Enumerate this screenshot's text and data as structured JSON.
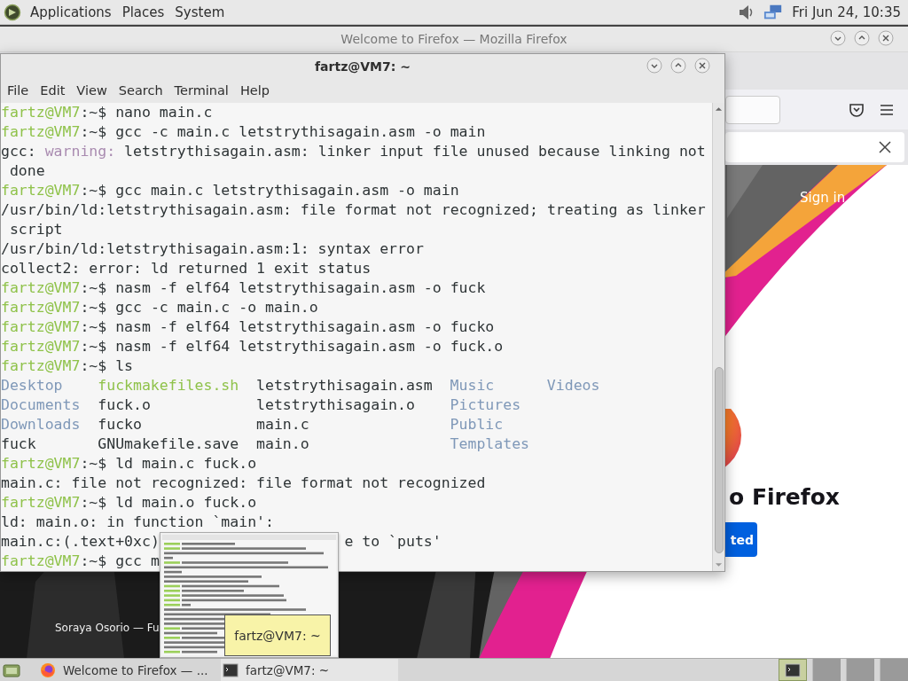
{
  "top_panel": {
    "menus": [
      "Applications",
      "Places",
      "System"
    ],
    "clock": "Fri Jun 24, 10:35"
  },
  "firefox": {
    "title": "Welcome to Firefox — Mozilla Firefox",
    "sign_in": "Sign in",
    "heading": "o Firefox",
    "button": "ted",
    "photo_credit": "Soraya Osorio — Fu"
  },
  "terminal": {
    "title": "fartz@VM7: ~",
    "menu": [
      "File",
      "Edit",
      "View",
      "Search",
      "Terminal",
      "Help"
    ],
    "lines": [
      {
        "kind": "cmd",
        "user": "fartz@VM7",
        "text": ":~$ nano main.c"
      },
      {
        "kind": "cmd",
        "user": "fartz@VM7",
        "text": ":~$ gcc -c main.c letstrythisagain.asm -o main"
      },
      {
        "kind": "warn",
        "lead": "gcc:",
        "tag": "warning:",
        "text": "letstrythisagain.asm: linker input file unused because linking not"
      },
      {
        "kind": "out",
        "text": " done"
      },
      {
        "kind": "cmd",
        "user": "fartz@VM7",
        "text": ":~$ gcc main.c letstrythisagain.asm -o main"
      },
      {
        "kind": "out",
        "text": "/usr/bin/ld:letstrythisagain.asm: file format not recognized; treating as linker"
      },
      {
        "kind": "out",
        "text": " script"
      },
      {
        "kind": "out",
        "text": "/usr/bin/ld:letstrythisagain.asm:1: syntax error"
      },
      {
        "kind": "out",
        "text": "collect2: error: ld returned 1 exit status"
      },
      {
        "kind": "cmd",
        "user": "fartz@VM7",
        "text": ":~$ nasm -f elf64 letstrythisagain.asm -o fuck"
      },
      {
        "kind": "cmd",
        "user": "fartz@VM7",
        "text": ":~$ gcc -c main.c -o main.o"
      },
      {
        "kind": "cmd",
        "user": "fartz@VM7",
        "text": ":~$ nasm -f elf64 letstrythisagain.asm -o fucko"
      },
      {
        "kind": "cmd",
        "user": "fartz@VM7",
        "text": ":~$ nasm -f elf64 letstrythisagain.asm -o fuck.o"
      },
      {
        "kind": "cmd",
        "user": "fartz@VM7",
        "text": ":~$ ls"
      },
      {
        "kind": "ls",
        "items": [
          {
            "name": "Desktop",
            "kind": "dir"
          },
          {
            "name": "fuckmakefiles.sh",
            "kind": "exec"
          },
          {
            "name": "letstrythisagain.asm",
            "kind": "file"
          },
          {
            "name": "Music",
            "kind": "dir"
          },
          {
            "name": "Videos",
            "kind": "dir"
          }
        ]
      },
      {
        "kind": "ls",
        "items": [
          {
            "name": "Documents",
            "kind": "dir"
          },
          {
            "name": "fuck.o",
            "kind": "file"
          },
          {
            "name": "letstrythisagain.o",
            "kind": "file"
          },
          {
            "name": "Pictures",
            "kind": "dir"
          }
        ]
      },
      {
        "kind": "ls",
        "items": [
          {
            "name": "Downloads",
            "kind": "dir"
          },
          {
            "name": "fucko",
            "kind": "file"
          },
          {
            "name": "main.c",
            "kind": "file"
          },
          {
            "name": "Public",
            "kind": "dir"
          }
        ]
      },
      {
        "kind": "ls",
        "items": [
          {
            "name": "fuck",
            "kind": "file"
          },
          {
            "name": "GNUmakefile.save",
            "kind": "file"
          },
          {
            "name": "main.o",
            "kind": "file"
          },
          {
            "name": "Templates",
            "kind": "dir"
          }
        ]
      },
      {
        "kind": "cmd",
        "user": "fartz@VM7",
        "text": ":~$ ld main.c fuck.o"
      },
      {
        "kind": "out",
        "text": "main.c: file not recognized: file format not recognized"
      },
      {
        "kind": "cmd",
        "user": "fartz@VM7",
        "text": ":~$ ld main.o fuck.o"
      },
      {
        "kind": "out",
        "text": "ld: main.o: in function `main':"
      },
      {
        "kind": "split",
        "parts": [
          "main.c:(.text+0xc)",
          "e to `puts'"
        ]
      },
      {
        "kind": "cmd",
        "user": "fartz@VM7",
        "text": ":~$ gcc m"
      }
    ]
  },
  "taskbar": {
    "tasks": [
      {
        "label": "Welcome to Firefox — ...",
        "kind": "browser",
        "selected": false
      },
      {
        "label": "fartz@VM7: ~",
        "kind": "terminal",
        "selected": true
      }
    ],
    "tooltip": "fartz@VM7: ~",
    "workspaces": [
      {
        "selected": true
      },
      {
        "selected": false
      },
      {
        "selected": false
      },
      {
        "selected": false
      }
    ]
  }
}
